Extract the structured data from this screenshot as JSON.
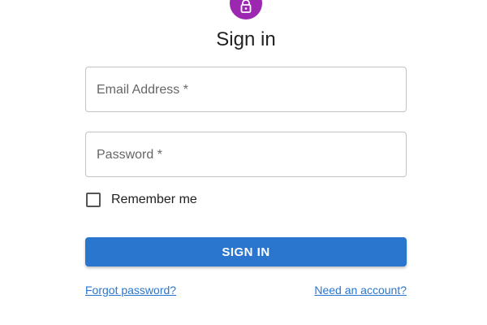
{
  "header": {
    "avatar_icon": "lock-icon",
    "avatar_color": "#9c27b0",
    "title": "Sign in"
  },
  "form": {
    "email": {
      "label": "Email Address *",
      "value": ""
    },
    "password": {
      "label": "Password *",
      "value": ""
    },
    "remember": {
      "label": "Remember me",
      "checked": false
    },
    "submit_label": "SIGN IN",
    "submit_color": "#2a76cf"
  },
  "links": {
    "forgot_password": "Forgot password?",
    "need_account": "Need an account?"
  }
}
